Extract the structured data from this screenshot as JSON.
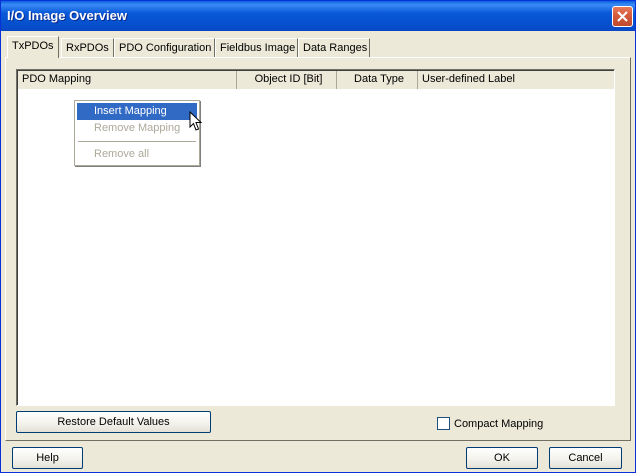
{
  "window": {
    "title": "I/O Image Overview"
  },
  "tabs": [
    {
      "label": "TxPDOs",
      "active": true
    },
    {
      "label": "RxPDOs",
      "active": false
    },
    {
      "label": "PDO Configuration",
      "active": false
    },
    {
      "label": "Fieldbus Image",
      "active": false
    },
    {
      "label": "Data Ranges",
      "active": false
    }
  ],
  "list": {
    "columns": [
      "PDO Mapping",
      "Object ID [Bit]",
      "Data Type",
      "User-defined Label"
    ],
    "rows": []
  },
  "context_menu": {
    "items": [
      {
        "label": "Insert Mapping",
        "state": "highlighted"
      },
      {
        "label": "Remove Mapping",
        "state": "disabled"
      },
      {
        "label": "Remove all",
        "state": "disabled"
      }
    ]
  },
  "buttons": {
    "restore_defaults": "Restore Default Values",
    "help": "Help",
    "ok": "OK",
    "cancel": "Cancel"
  },
  "compact_mapping": {
    "label": "Compact Mapping",
    "checked": false
  }
}
